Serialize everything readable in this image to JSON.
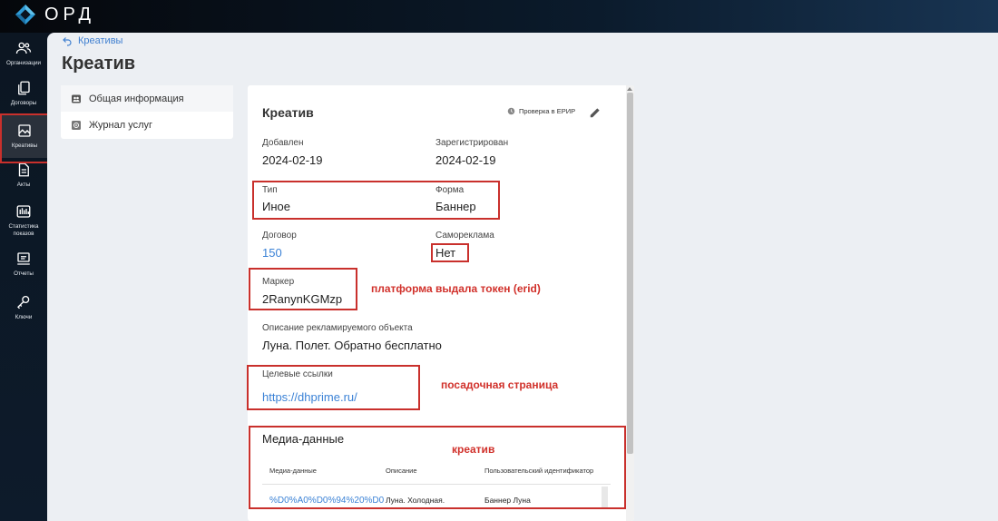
{
  "app": {
    "logo_text": "ОРД"
  },
  "sidebar": {
    "items": [
      {
        "label": "Организации",
        "icon": "people-icon"
      },
      {
        "label": "Договоры",
        "icon": "documents-icon"
      },
      {
        "label": "Креативы",
        "icon": "image-icon",
        "active": true
      },
      {
        "label": "Акты",
        "icon": "document-icon"
      },
      {
        "label": "Статистика показов",
        "icon": "stats-icon"
      },
      {
        "label": "Отчеты",
        "icon": "report-icon"
      },
      {
        "label": "Ключи",
        "icon": "key-icon"
      }
    ]
  },
  "breadcrumb": {
    "back_label": "Креативы"
  },
  "page": {
    "title": "Креатив"
  },
  "tabs": [
    {
      "label": "Общая информация",
      "icon": "people-icon",
      "active": true
    },
    {
      "label": "Журнал услуг",
      "icon": "gear-icon"
    }
  ],
  "creative": {
    "card_title": "Креатив",
    "check_label": "Проверка в ЕРИР",
    "added_label": "Добавлен",
    "added_value": "2024-02-19",
    "registered_label": "Зарегистрирован",
    "registered_value": "2024-02-19",
    "type_label": "Тип",
    "type_value": "Иное",
    "form_label": "Форма",
    "form_value": "Баннер",
    "contract_label": "Договор",
    "contract_value": "150",
    "selfad_label": "Самореклама",
    "selfad_value": "Нет",
    "marker_label": "Маркер",
    "marker_value": "2RanynKGMzp",
    "description_label": "Описание рекламируемого объекта",
    "description_value": "Луна. Полет. Обратно бесплатно",
    "target_links_label": "Целевые ссылки",
    "target_link_value": "https://dhprime.ru/"
  },
  "media": {
    "title": "Медиа-данные",
    "columns": [
      "Медиа-данные",
      "Описание",
      "Пользовательский идентификатор"
    ],
    "rows": [
      {
        "media": "%D0%A0%D0%94%20%D0",
        "description": "Луна. Холодная.",
        "user_id": "Баннер Луна"
      }
    ]
  },
  "annotations": {
    "marker_note": "платформа выдала токен (erid)",
    "links_note": "посадочная страница",
    "media_note": "креатив"
  },
  "colors": {
    "accent": "#3b82d6",
    "annotation": "#c9302c",
    "sidebar_active": "#4caf50"
  }
}
